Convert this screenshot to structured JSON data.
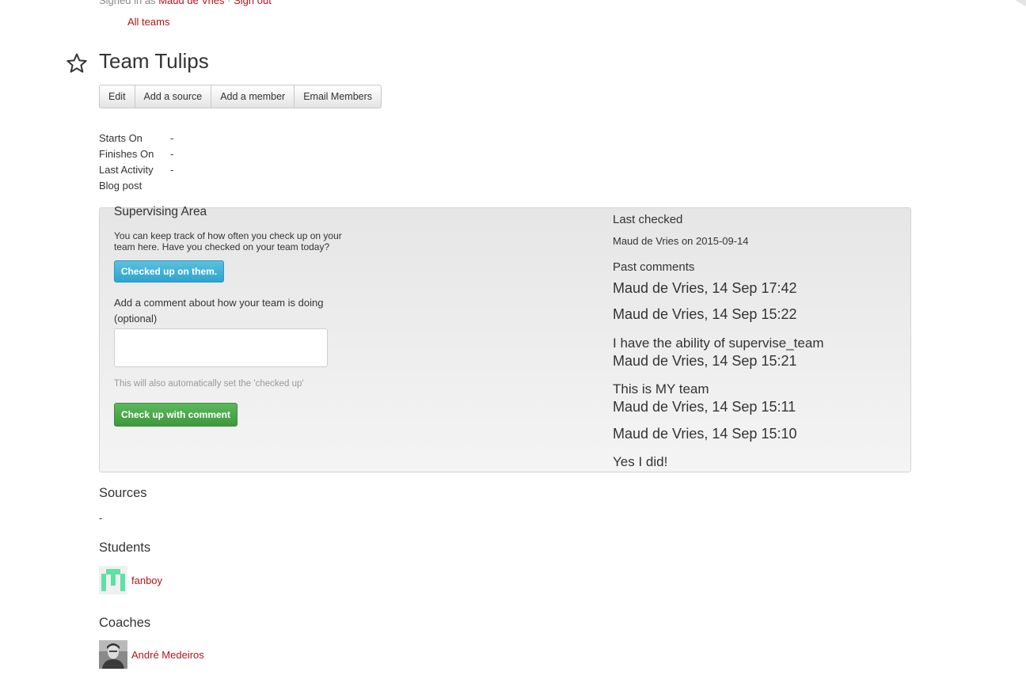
{
  "header": {
    "signed_in_prefix": "Signed in as",
    "user_name": "Maud de Vries",
    "separator": "·",
    "sign_out": "Sign out",
    "all_teams": "All teams"
  },
  "team": {
    "title": "Team Tulips",
    "favorite_icon": "star-outline-icon"
  },
  "actions": {
    "edit": "Edit",
    "add_source": "Add a source",
    "add_member": "Add a member",
    "email_members": "Email Members"
  },
  "meta": [
    {
      "label": "Starts On",
      "value": "-"
    },
    {
      "label": "Finishes On",
      "value": "-"
    },
    {
      "label": "Last Activity",
      "value": "-"
    },
    {
      "label": "Blog post",
      "value": ""
    }
  ],
  "supervising": {
    "title": "Supervising Area",
    "help": "You can keep track of how often you check up on your team here. Have you checked on your team today?",
    "checked_button": "Checked up on them.",
    "comment_label": "Add a comment about how your team is doing (optional)",
    "note": "This will also automatically set the 'checked up'",
    "comment_button": "Check up with comment",
    "last_checked_heading": "Last checked",
    "last_checked_value": "Maud de Vries on 2015-09-14",
    "past_heading": "Past comments",
    "comments": [
      {
        "author": "Maud de Vries, 14 Sep 17:42",
        "body": ""
      },
      {
        "author": "Maud de Vries, 14 Sep 15:22",
        "body": ""
      },
      {
        "author": "Maud de Vries, 14 Sep 15:21",
        "body": "I have the ability of supervise_team"
      },
      {
        "author": "Maud de Vries, 14 Sep 15:11",
        "body": "This is MY team"
      },
      {
        "author": "Maud de Vries, 14 Sep 15:10",
        "body": ""
      },
      {
        "author": "",
        "body": "Yes I did!"
      }
    ]
  },
  "sources": {
    "heading": "Sources",
    "empty": "-"
  },
  "students": {
    "heading": "Students",
    "items": [
      {
        "name": "fanboy",
        "avatar": "identicon"
      }
    ]
  },
  "coaches": {
    "heading": "Coaches",
    "items": [
      {
        "name": "André Medeiros",
        "avatar": "photo"
      }
    ]
  },
  "colors": {
    "link": "#b5131a",
    "info_button": "#5bc0de",
    "success_button": "#5cb85c",
    "panel_bg": "#ececec",
    "identicon": "#5fe0a4"
  }
}
